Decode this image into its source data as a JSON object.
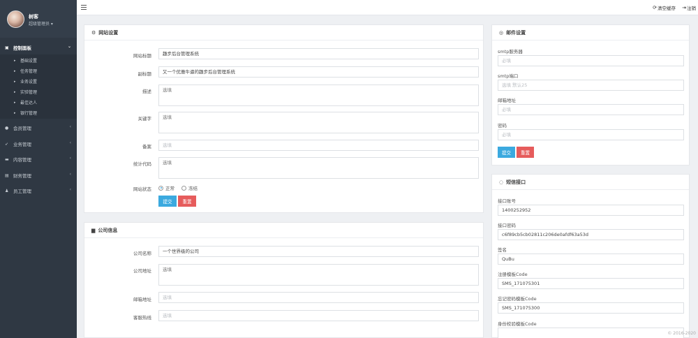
{
  "sidebar": {
    "user": {
      "name": "树客",
      "role": "超级管理员 ▾"
    },
    "groups": [
      {
        "label": "控制面板",
        "icon": "dashboard-icon",
        "active": true
      },
      {
        "label": "会员管理",
        "icon": "user-icon"
      },
      {
        "label": "业务管理",
        "icon": "rocket-icon"
      },
      {
        "label": "内容管理",
        "icon": "content-icon"
      },
      {
        "label": "财务管理",
        "icon": "finance-icon"
      },
      {
        "label": "员工管理",
        "icon": "staff-icon"
      }
    ],
    "subitems": [
      "基础设置",
      "任务管理",
      "业务设置",
      "实验管理",
      "最佳达人",
      "银行管理"
    ]
  },
  "topbar": {
    "clear_cache": "清空缓存",
    "logout": "注销"
  },
  "website": {
    "title": "网站设置",
    "labels": {
      "site_title": "网站标题",
      "subtitle": "副标题",
      "description": "描述",
      "keywords": "关键字",
      "record": "备案",
      "stats_code": "统计代码",
      "status": "网站状态"
    },
    "values": {
      "site_title": "趣步后台管理系统",
      "subtitle": "又一个优雅牛逼的趣步后台管理系统"
    },
    "placeholder": "选填",
    "status_options": {
      "normal": "正常",
      "frozen": "冻结"
    },
    "submit": "提交",
    "reset": "重置"
  },
  "company": {
    "title": "公司信息",
    "labels": {
      "name": "公司名称",
      "address": "公司地址",
      "email": "邮箱地址",
      "hotline": "客服热线"
    },
    "values": {
      "name": "一个世界级的公司"
    },
    "placeholder": "选填"
  },
  "mail": {
    "title": "邮件设置",
    "labels": {
      "server": "smtp服务器",
      "port": "smtp端口",
      "address": "邮箱地址",
      "password": "密码"
    },
    "placeholders": {
      "server": "必填",
      "port": "选填 默认25",
      "address": "必填",
      "password": "必填"
    },
    "submit": "提交",
    "reset": "重置"
  },
  "sms": {
    "title": "短信接口",
    "labels": {
      "account": "接口账号",
      "password": "接口密码",
      "sign": "签名",
      "reg_code": "注册模板Code",
      "forget_code": "忘记密码模板Code",
      "verify_code": "身份校验模板Code"
    },
    "values": {
      "account": "1400252952",
      "password": "c6f89cb5cb02811c206de0afdf63a53d",
      "sign": "QuBu",
      "reg_code": "SMS_171075301",
      "forget_code": "SMS_171075300"
    }
  },
  "copyright": "© 2016-2020"
}
